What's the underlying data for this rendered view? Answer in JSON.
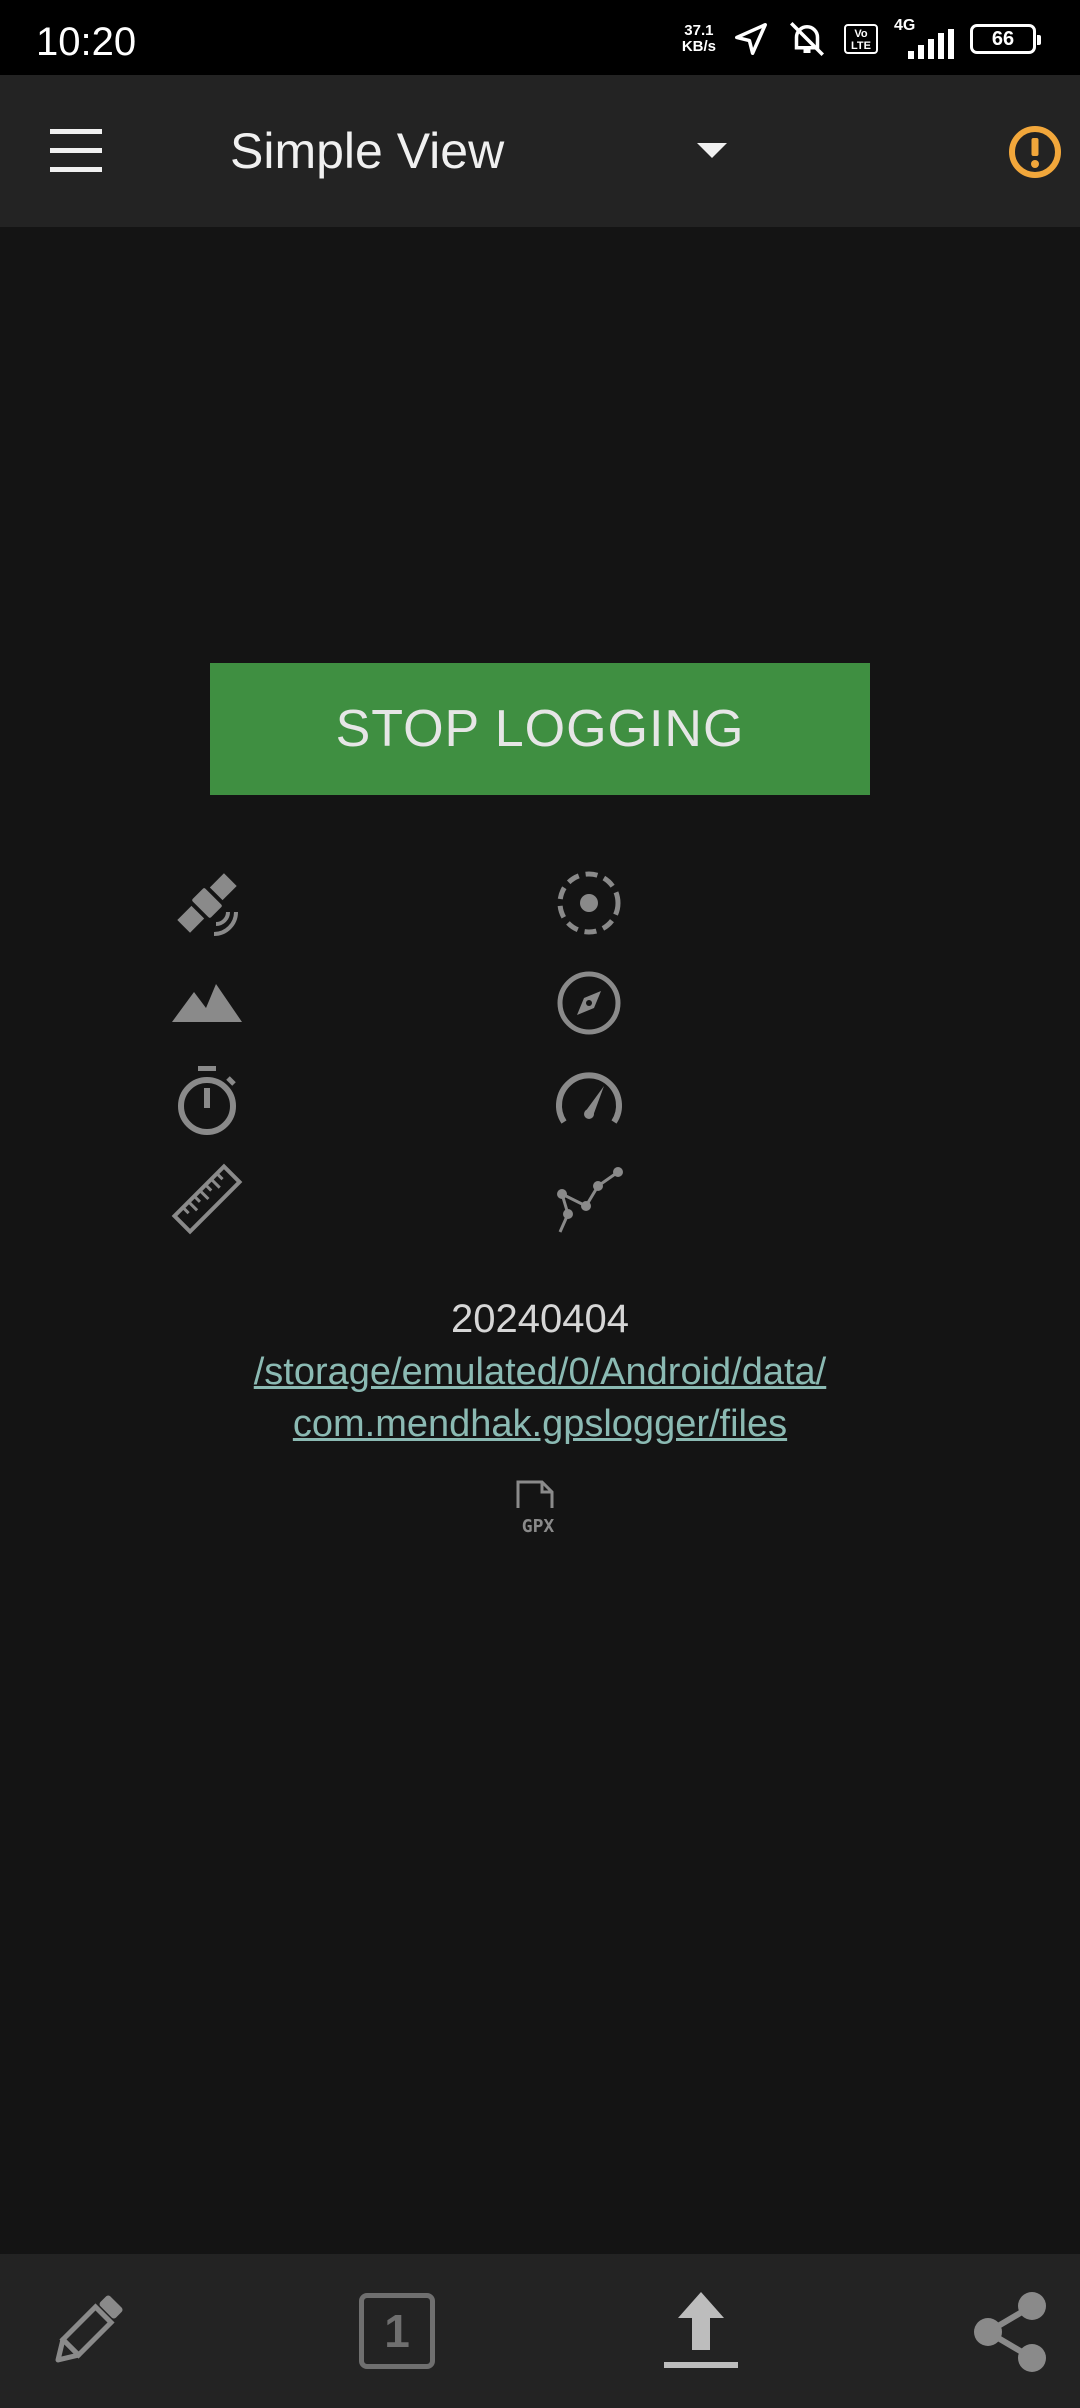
{
  "status_bar": {
    "time": "10:20",
    "net_speed_value": "37.1",
    "net_speed_unit": "KB/s",
    "network_type": "4G",
    "volte": "Vo LTE",
    "battery": "66"
  },
  "toolbar": {
    "title": "Simple View",
    "menu_icon": "menu-icon",
    "warning_icon": "warning-icon",
    "warning_color": "#f2a73b"
  },
  "main": {
    "stop_button_label": "STOP LOGGING",
    "button_color": "#3f8f41",
    "metrics_left": [
      "satellite-icon",
      "altitude-icon",
      "timer-icon",
      "distance-icon"
    ],
    "metrics_right": [
      "accuracy-icon",
      "direction-icon",
      "speed-icon",
      "points-icon"
    ],
    "log_name": "20240404",
    "log_path_line1": "/storage/emulated/0/Android/data/",
    "log_path_line2": "com.mendhak.gpslogger/files",
    "log_format_label": "GPX",
    "link_color": "#8bbab3"
  },
  "bottom_bar": {
    "annotate_icon": "pencil-icon",
    "single_point_label": "1",
    "upload_icon": "upload-icon",
    "share_icon": "share-icon"
  }
}
